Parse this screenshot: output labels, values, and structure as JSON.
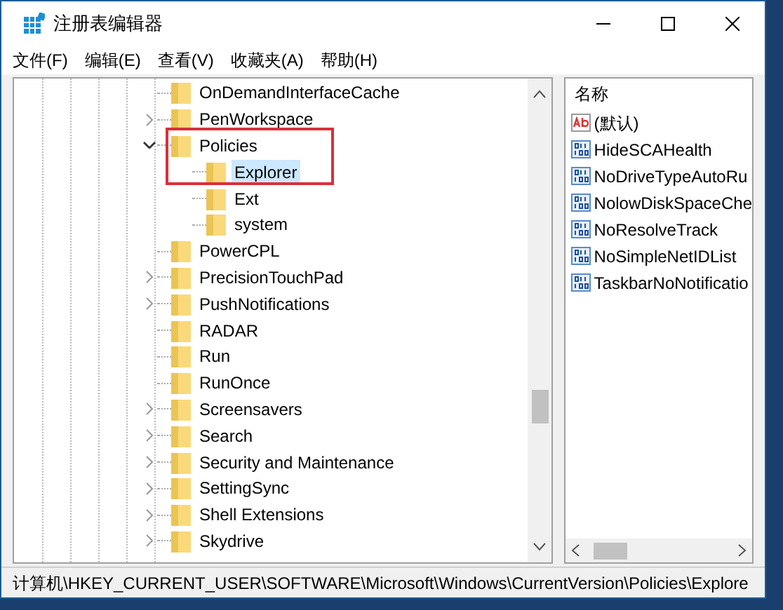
{
  "window": {
    "title": "注册表编辑器"
  },
  "menu": [
    "文件(F)",
    "编辑(E)",
    "查看(V)",
    "收藏夹(A)",
    "帮助(H)"
  ],
  "tree": {
    "items": [
      {
        "label": "OnDemandInterfaceCache",
        "has_children": false,
        "selected": false
      },
      {
        "label": "PenWorkspace",
        "has_children": true,
        "expanded": false,
        "selected": false
      },
      {
        "label": "Policies",
        "has_children": true,
        "expanded": true,
        "selected": false,
        "children": [
          {
            "label": "Explorer",
            "has_children": false,
            "selected": true
          },
          {
            "label": "Ext",
            "has_children": false,
            "selected": false
          },
          {
            "label": "system",
            "has_children": false,
            "selected": false
          }
        ]
      },
      {
        "label": "PowerCPL",
        "has_children": false,
        "selected": false
      },
      {
        "label": "PrecisionTouchPad",
        "has_children": true,
        "expanded": false,
        "selected": false
      },
      {
        "label": "PushNotifications",
        "has_children": true,
        "expanded": false,
        "selected": false
      },
      {
        "label": "RADAR",
        "has_children": false,
        "selected": false
      },
      {
        "label": "Run",
        "has_children": false,
        "selected": false
      },
      {
        "label": "RunOnce",
        "has_children": false,
        "selected": false
      },
      {
        "label": "Screensavers",
        "has_children": true,
        "expanded": false,
        "selected": false
      },
      {
        "label": "Search",
        "has_children": true,
        "expanded": false,
        "selected": false
      },
      {
        "label": "Security and Maintenance",
        "has_children": true,
        "expanded": false,
        "selected": false
      },
      {
        "label": "SettingSync",
        "has_children": true,
        "expanded": false,
        "selected": false
      },
      {
        "label": "Shell Extensions",
        "has_children": true,
        "expanded": false,
        "selected": false
      },
      {
        "label": "Skydrive",
        "has_children": true,
        "expanded": false,
        "selected": false
      }
    ]
  },
  "values": {
    "column": "名称",
    "items": [
      {
        "name": "(默认)",
        "kind": "string"
      },
      {
        "name": "HideSCAHealth",
        "kind": "dword"
      },
      {
        "name": "NoDriveTypeAutoRu",
        "kind": "dword"
      },
      {
        "name": "NolowDiskSpaceChe",
        "kind": "dword"
      },
      {
        "name": "NoResolveTrack",
        "kind": "dword"
      },
      {
        "name": "NoSimpleNetIDList",
        "kind": "dword"
      },
      {
        "name": "TaskbarNoNotificatio",
        "kind": "dword"
      }
    ]
  },
  "status_bar": "计算机\\HKEY_CURRENT_USER\\SOFTWARE\\Microsoft\\Windows\\CurrentVersion\\Policies\\Explore"
}
